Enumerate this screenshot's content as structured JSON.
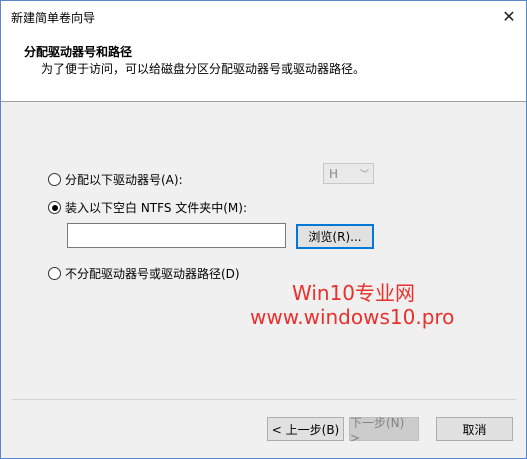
{
  "window": {
    "title": "新建简单卷向导",
    "close_glyph": "✕"
  },
  "header": {
    "title": "分配驱动器号和路径",
    "subtitle": "为了便于访问，可以给磁盘分区分配驱动器号或驱动器路径。"
  },
  "options": {
    "assign_letter": {
      "label": "分配以下驱动器号(A):",
      "checked": false
    },
    "drive_letter": {
      "value": "H",
      "arrow": "﹀"
    },
    "mount_folder": {
      "label": "装入以下空白 NTFS 文件夹中(M):",
      "checked": true
    },
    "folder_path": {
      "value": ""
    },
    "browse_label": "浏览(R)...",
    "no_assign": {
      "label": "不分配驱动器号或驱动器路径(D)",
      "checked": false
    }
  },
  "watermark": {
    "line1": "Win10专业网",
    "line2": "www.windows10.pro",
    "color": "#e8302d"
  },
  "footer": {
    "back_label": "< 上一步(B)",
    "next_label": "下一步(N) >",
    "cancel_label": "取消"
  }
}
